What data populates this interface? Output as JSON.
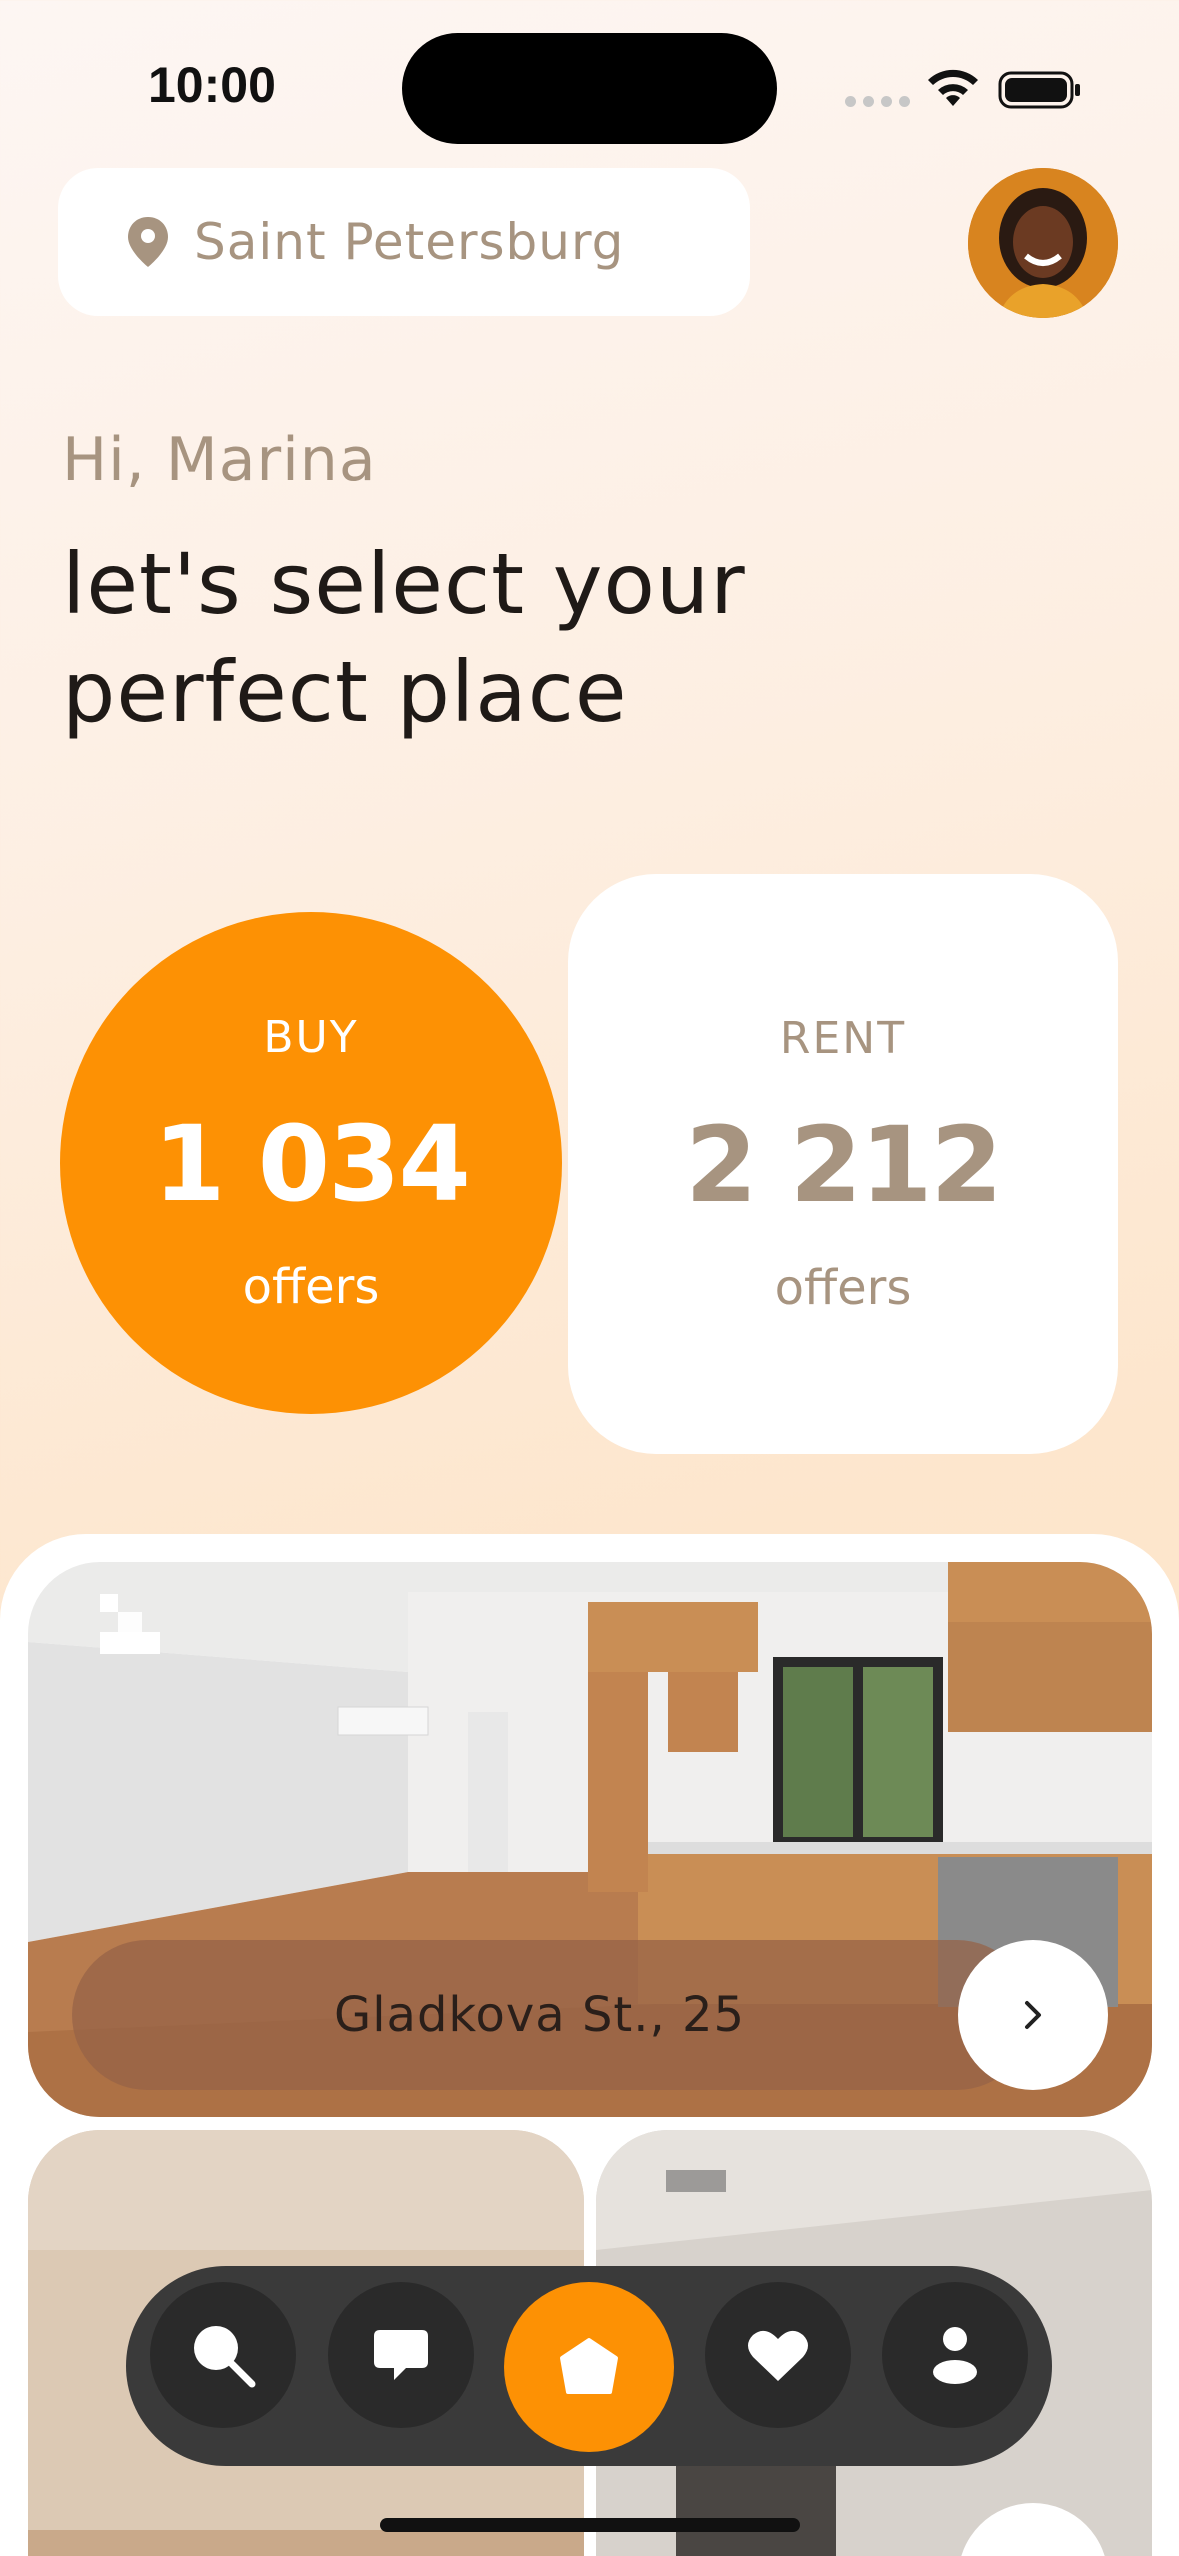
{
  "status_bar": {
    "time": "10:00"
  },
  "location": {
    "city": "Saint Petersburg"
  },
  "user": {
    "avatar_alt": "user avatar"
  },
  "greeting": {
    "hello": "Hi, Marina",
    "headline_line1": "let's select your",
    "headline_line2": "perfect place"
  },
  "offers": {
    "buy": {
      "label": "BUY",
      "count": "1 034",
      "unit": "offers"
    },
    "rent": {
      "label": "RENT",
      "count": "2 212",
      "unit": "offers"
    }
  },
  "listings": [
    {
      "address": "Gladkova St., 25"
    }
  ],
  "nav": {
    "items": [
      {
        "icon": "search-icon"
      },
      {
        "icon": "chat-icon"
      },
      {
        "icon": "home-icon",
        "active": true
      },
      {
        "icon": "heart-icon"
      },
      {
        "icon": "profile-icon"
      }
    ]
  },
  "colors": {
    "accent": "#fd9104",
    "muted": "#a79480",
    "dark_nav": "#3a3a3a"
  }
}
